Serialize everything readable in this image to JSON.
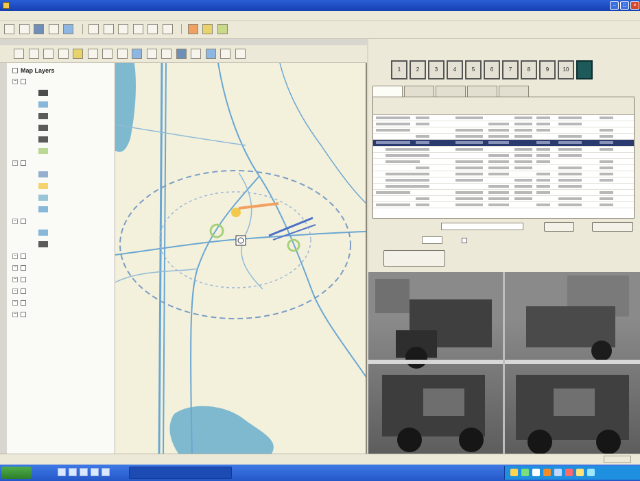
{
  "window": {
    "title": ""
  },
  "menu": [
    {
      "label": ""
    },
    {
      "label": ""
    },
    {
      "label": ""
    },
    {
      "label": ""
    },
    {
      "label": ""
    },
    {
      "label": ""
    },
    {
      "label": ""
    }
  ],
  "layers": {
    "title": "Map Layers",
    "items": [
      {
        "label": "",
        "level": 0
      },
      {
        "label": "",
        "level": 2
      },
      {
        "label": "",
        "level": 2
      },
      {
        "label": "",
        "level": 2
      },
      {
        "label": "",
        "level": 2
      },
      {
        "label": "",
        "level": 2
      },
      {
        "label": "",
        "level": 2
      },
      {
        "label": "",
        "level": 0
      },
      {
        "label": "",
        "level": 2
      },
      {
        "label": "",
        "level": 2
      },
      {
        "label": "",
        "level": 2
      },
      {
        "label": "",
        "level": 2
      },
      {
        "label": "",
        "level": 0
      },
      {
        "label": "",
        "level": 2
      },
      {
        "label": "",
        "level": 2
      },
      {
        "label": "",
        "level": 0
      },
      {
        "label": "",
        "level": 0
      },
      {
        "label": "",
        "level": 0
      },
      {
        "label": "",
        "level": 0
      },
      {
        "label": "",
        "level": 0
      },
      {
        "label": "",
        "level": 0
      }
    ]
  },
  "right": {
    "header_left": "",
    "header_right": "",
    "subheader": "",
    "frames_label": "",
    "frames": [
      "1",
      "2",
      "3",
      "4",
      "5",
      "6",
      "7",
      "8",
      "9",
      "10",
      ""
    ],
    "tabs": [
      {
        "label": ""
      },
      {
        "label": ""
      },
      {
        "label": ""
      },
      {
        "label": ""
      },
      {
        "label": ""
      }
    ],
    "form": {
      "label1": "",
      "value1": "",
      "button1": "",
      "button2": "",
      "label2": "",
      "value2": "",
      "check_label": "",
      "action_button": ""
    }
  },
  "colors": {
    "water": "#7fb9cf",
    "road": "#6aa6d2",
    "land": "#f3f1dc",
    "buffer": "#7a9cc4",
    "selected_row": "#2a3a6e",
    "taskbar": "#2457c8"
  }
}
